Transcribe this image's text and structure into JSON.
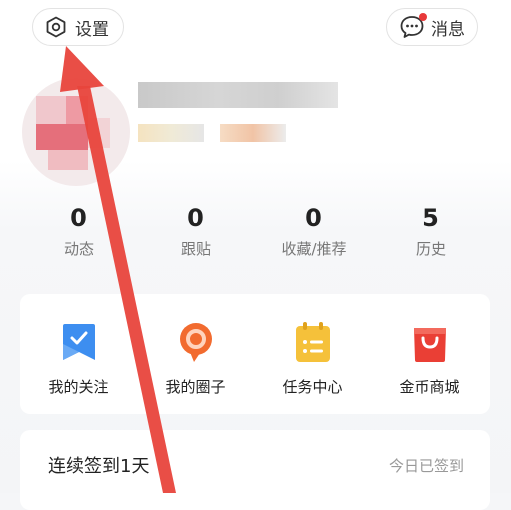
{
  "header": {
    "settings_label": "设置",
    "messages_label": "消息",
    "settings_icon": "hexagon-gear-icon",
    "messages_icon": "chat-bubble-icon",
    "notification_dot_color": "#e8393a"
  },
  "stats": [
    {
      "value": "0",
      "label": "动态"
    },
    {
      "value": "0",
      "label": "跟贴"
    },
    {
      "value": "0",
      "label": "收藏/推荐"
    },
    {
      "value": "5",
      "label": "历史"
    }
  ],
  "shortcuts": [
    {
      "label": "我的关注",
      "icon": "bookmark-check-icon",
      "color": "#3d8ef0"
    },
    {
      "label": "我的圈子",
      "icon": "orange-bubble-icon",
      "color": "#f26b2f"
    },
    {
      "label": "任务中心",
      "icon": "clipboard-list-icon",
      "color": "#f5c13a"
    },
    {
      "label": "金币商城",
      "icon": "shopping-bag-icon",
      "color": "#ea3f35"
    }
  ],
  "signin": {
    "title": "连续签到1天",
    "status": "今日已签到"
  },
  "annotation": {
    "arrow_color": "#e8453c"
  }
}
